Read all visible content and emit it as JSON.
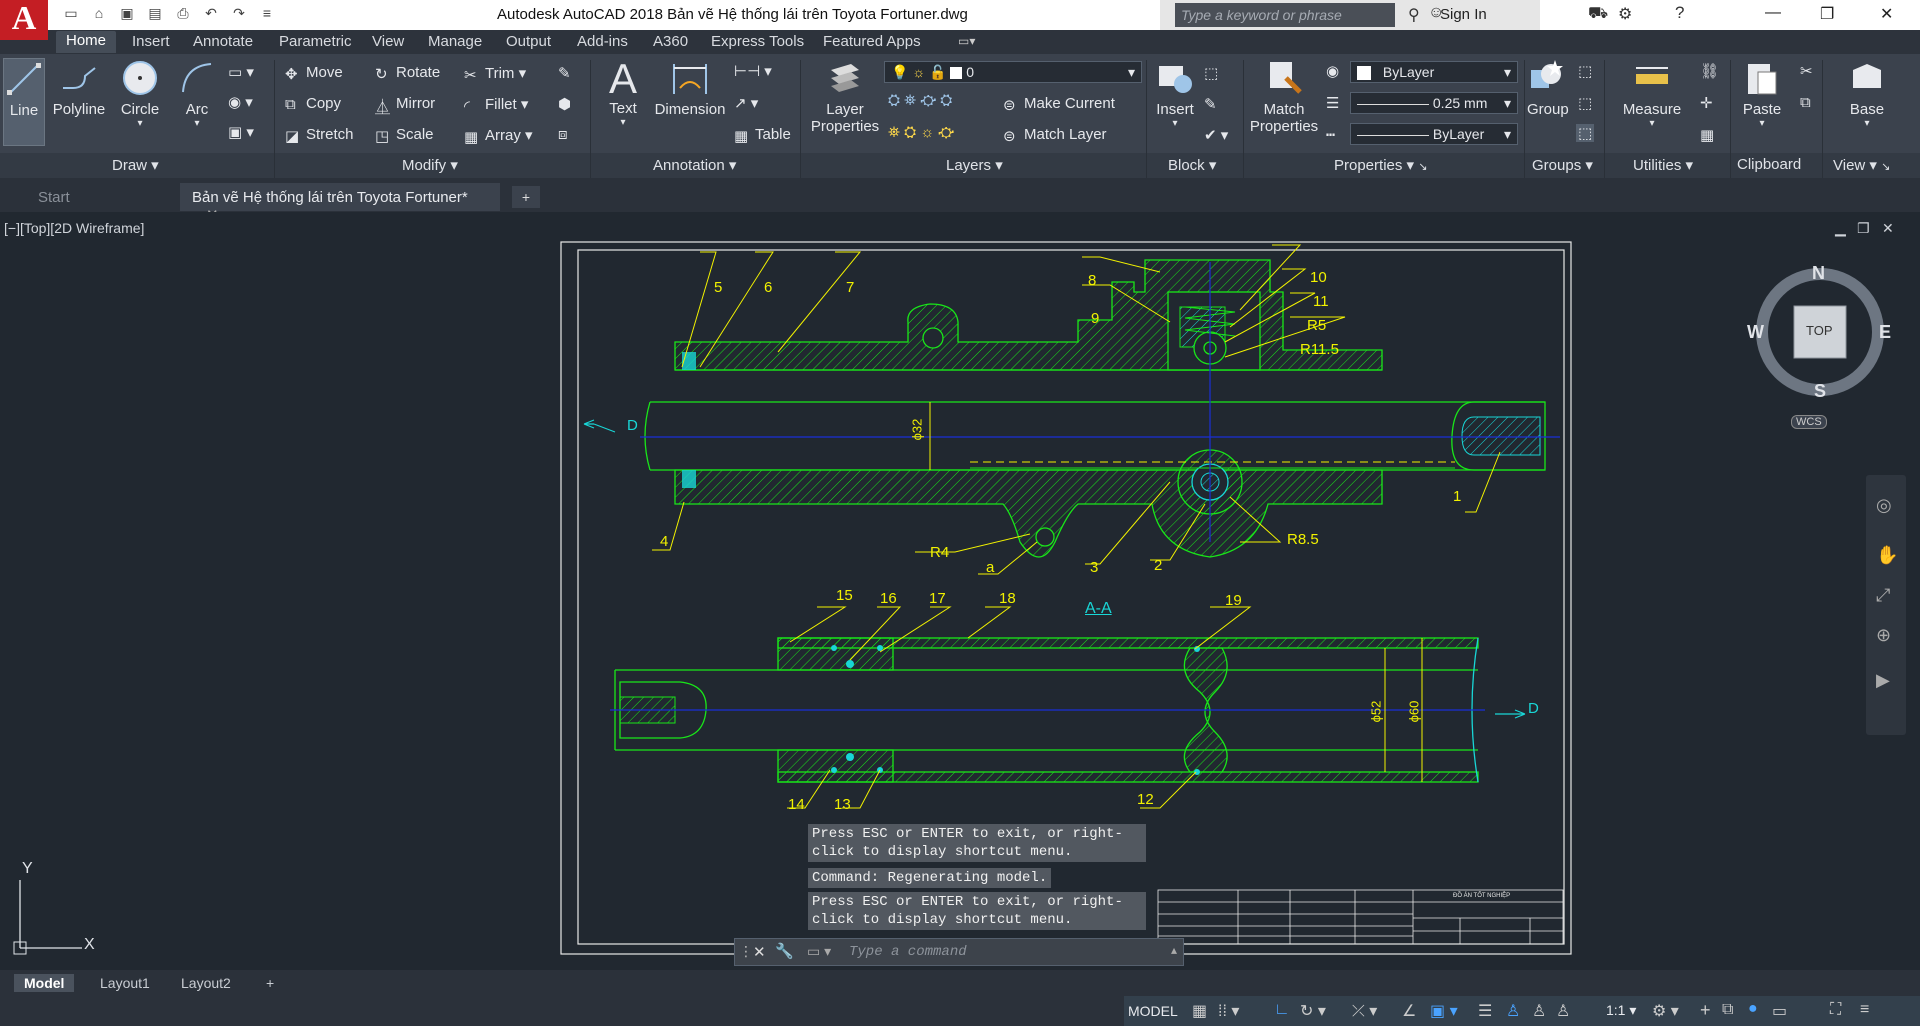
{
  "title_bar": {
    "app_title": "Autodesk AutoCAD 2018    Bản vẽ Hệ thống lái trên Toyota Fortuner.dwg",
    "search_placeholder": "Type a keyword or phrase",
    "sign_in": "Sign In"
  },
  "ribbon_tabs": [
    "Home",
    "Insert",
    "Annotate",
    "Parametric",
    "View",
    "Manage",
    "Output",
    "Add-ins",
    "A360",
    "Express Tools",
    "Featured Apps"
  ],
  "draw": {
    "line": "Line",
    "polyline": "Polyline",
    "circle": "Circle",
    "arc": "Arc",
    "panel": "Draw"
  },
  "modify": {
    "move": "Move",
    "rotate": "Rotate",
    "trim": "Trim",
    "copy": "Copy",
    "mirror": "Mirror",
    "fillet": "Fillet",
    "stretch": "Stretch",
    "scale": "Scale",
    "array": "Array",
    "panel": "Modify"
  },
  "annotation": {
    "text": "Text",
    "dimension": "Dimension",
    "table": "Table",
    "panel": "Annotation"
  },
  "layers": {
    "layer_properties_1": "Layer",
    "layer_properties_2": "Properties",
    "current_layer": "0",
    "make_current": "Make Current",
    "match_layer": "Match Layer",
    "panel": "Layers"
  },
  "block": {
    "insert": "Insert",
    "panel": "Block"
  },
  "properties": {
    "match_1": "Match",
    "match_2": "Properties",
    "color": "ByLayer",
    "lineweight": "0.25 mm",
    "linetype": "ByLayer",
    "panel": "Properties"
  },
  "groups": {
    "group": "Group",
    "panel": "Groups"
  },
  "utilities": {
    "measure": "Measure",
    "panel": "Utilities"
  },
  "clipboard": {
    "paste": "Paste",
    "panel": "Clipboard"
  },
  "view_panel": {
    "base": "Base",
    "panel": "View"
  },
  "doc_tabs": {
    "start": "Start",
    "drawing": "Bản vẽ Hệ thống lái trên Toyota Fortuner*"
  },
  "viewport": {
    "label": "[−][Top][2D Wireframe]"
  },
  "navcube": {
    "n": "N",
    "s": "S",
    "e": "E",
    "w": "W",
    "top": "TOP",
    "wcs": "WCS"
  },
  "drawing": {
    "section_label": "A-A",
    "arrow_label": "D",
    "dims": {
      "d32": "ϕ32",
      "d52": "ϕ52",
      "d60": "ϕ60"
    },
    "radii": {
      "r5": "R5",
      "r11_5": "R11.5",
      "r4": "R4",
      "r8_5": "R8.5",
      "a": "a"
    },
    "part_numbers": [
      "1",
      "2",
      "3",
      "4",
      "5",
      "6",
      "7",
      "8",
      "9",
      "10",
      "11",
      "12",
      "13",
      "14",
      "15",
      "16",
      "17",
      "18",
      "19"
    ],
    "title_block_header": "ĐỒ ÁN TỐT NGHIỆP"
  },
  "command": {
    "hist1_line1": "Press ESC or ENTER to exit, or right-",
    "hist1_line2": "click to display shortcut menu.",
    "hist2": "Command: Regenerating model.",
    "hist3_line1": "Press ESC or ENTER to exit, or right-",
    "hist3_line2": "click to display shortcut menu.",
    "placeholder": "Type a command"
  },
  "layout_tabs": [
    "Model",
    "Layout1",
    "Layout2"
  ],
  "status": {
    "model": "MODEL",
    "scale": "1:1"
  },
  "ucs": {
    "x": "X",
    "y": "Y"
  },
  "colors": {
    "accent": "#c41e24",
    "ribbon": "#3b424d",
    "canvas": "#212830",
    "outline": "#19e619",
    "centerline": "#1a2fd6",
    "label": "#f2f200"
  }
}
